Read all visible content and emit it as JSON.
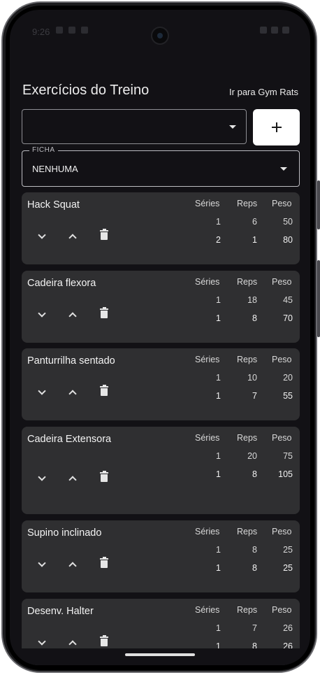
{
  "status": {
    "time": "9:26"
  },
  "header": {
    "title": "Exercícios do Treino",
    "gym_link": "Ir para Gym Rats"
  },
  "exercise_select": {
    "value": ""
  },
  "ficha": {
    "label": "FICHA",
    "value": "NENHUMA"
  },
  "columns": {
    "series": "Séries",
    "reps": "Reps",
    "peso": "Peso"
  },
  "exercises": [
    {
      "name": "Hack Squat",
      "rows": [
        {
          "series": "1",
          "reps": "6",
          "peso": "50"
        },
        {
          "series": "2",
          "reps": "1",
          "peso": "80"
        }
      ]
    },
    {
      "name": "Cadeira flexora",
      "rows": [
        {
          "series": "1",
          "reps": "18",
          "peso": "45"
        },
        {
          "series": "1",
          "reps": "8",
          "peso": "70"
        }
      ]
    },
    {
      "name": "Panturrilha sentado",
      "rows": [
        {
          "series": "1",
          "reps": "10",
          "peso": "20"
        },
        {
          "series": "1",
          "reps": "7",
          "peso": "55"
        }
      ]
    },
    {
      "name": "Cadeira Extensora",
      "rows": [
        {
          "series": "1",
          "reps": "20",
          "peso": "75"
        },
        {
          "series": "1",
          "reps": "8",
          "peso": "105"
        }
      ]
    },
    {
      "name": "Supino inclinado",
      "rows": [
        {
          "series": "1",
          "reps": "8",
          "peso": "25"
        },
        {
          "series": "1",
          "reps": "8",
          "peso": "25"
        }
      ]
    },
    {
      "name": "Desenv. Halter",
      "rows": [
        {
          "series": "1",
          "reps": "7",
          "peso": "26"
        },
        {
          "series": "1",
          "reps": "8",
          "peso": "26"
        }
      ]
    }
  ]
}
